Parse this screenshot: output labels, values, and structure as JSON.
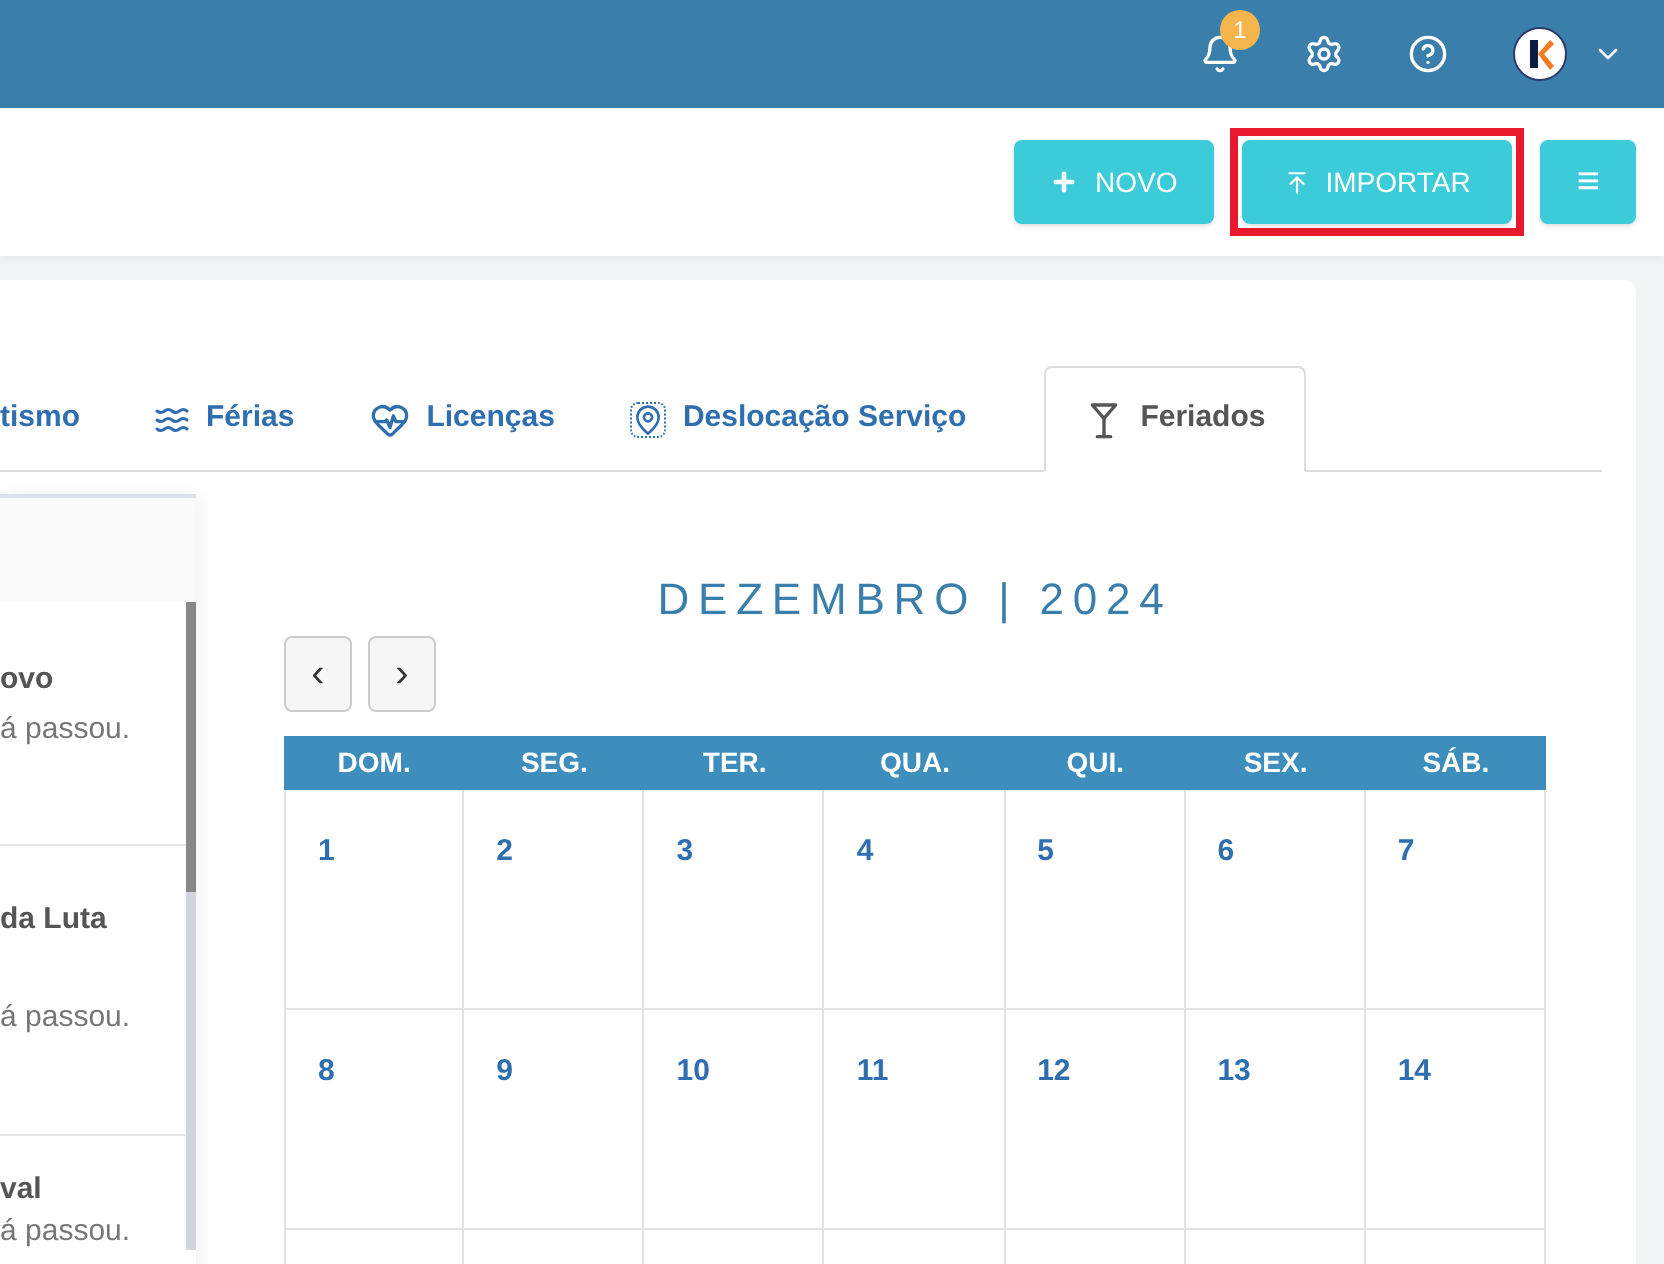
{
  "header": {
    "notification_count": "1"
  },
  "toolbar": {
    "buttons": [
      {
        "kind": "new",
        "label": "NOVO",
        "highlighted": false
      },
      {
        "kind": "import",
        "label": "IMPORTAR",
        "highlighted": true
      },
      {
        "kind": "menu",
        "label": "≡",
        "highlighted": false
      }
    ]
  },
  "tabs": [
    {
      "kind": "plain",
      "label": "tismo",
      "selected": false
    },
    {
      "kind": "swim",
      "label": "Férias",
      "selected": false
    },
    {
      "kind": "heart",
      "label": "Licenças",
      "selected": false
    },
    {
      "kind": "route",
      "label": "Deslocação Serviço",
      "selected": false
    },
    {
      "kind": "cocktail",
      "label": "Feriados",
      "selected": true
    }
  ],
  "holiday_list": [
    {
      "title": "ovo",
      "note": "á passou."
    },
    {
      "title": "da Luta",
      "note": "á passou."
    },
    {
      "title": "val",
      "note": "á passou."
    }
  ],
  "calendar": {
    "title": "DEZEMBRO | 2024",
    "prev": "‹",
    "next": "›",
    "weekdays": [
      "DOM.",
      "SEG.",
      "TER.",
      "QUA.",
      "QUI.",
      "SEX.",
      "SÁB."
    ],
    "weeks": [
      [
        "1",
        "2",
        "3",
        "4",
        "5",
        "6",
        "7"
      ],
      [
        "8",
        "9",
        "10",
        "11",
        "12",
        "13",
        "14"
      ]
    ]
  }
}
